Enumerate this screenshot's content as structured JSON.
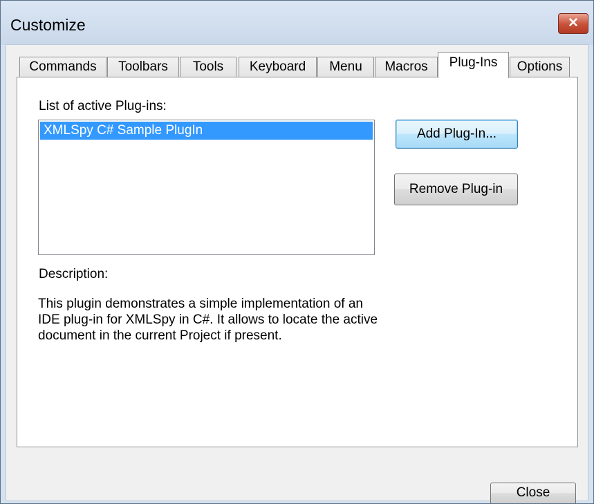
{
  "window": {
    "title": "Customize",
    "close_glyph": "✕"
  },
  "tabs": [
    {
      "label": "Commands",
      "active": false
    },
    {
      "label": "Toolbars",
      "active": false
    },
    {
      "label": "Tools",
      "active": false
    },
    {
      "label": "Keyboard",
      "active": false
    },
    {
      "label": "Menu",
      "active": false
    },
    {
      "label": "Macros",
      "active": false
    },
    {
      "label": "Plug-Ins",
      "active": true
    },
    {
      "label": "Options",
      "active": false
    }
  ],
  "plugins": {
    "list_label": "List of active Plug-ins:",
    "items": [
      "XMLSpy C# Sample PlugIn"
    ],
    "selected_index": 0,
    "add_button": "Add Plug-In...",
    "remove_button": "Remove Plug-in"
  },
  "description": {
    "label": "Description:",
    "text": " This plugin demonstrates a simple implementation of an IDE plug-in for XMLSpy in C#. It allows to locate the active document in the current Project if present."
  },
  "footer": {
    "close_button": "Close"
  },
  "colors": {
    "selection": "#3399ff",
    "close_button": "#c8513a",
    "title_bar": "#c9d8ea"
  }
}
